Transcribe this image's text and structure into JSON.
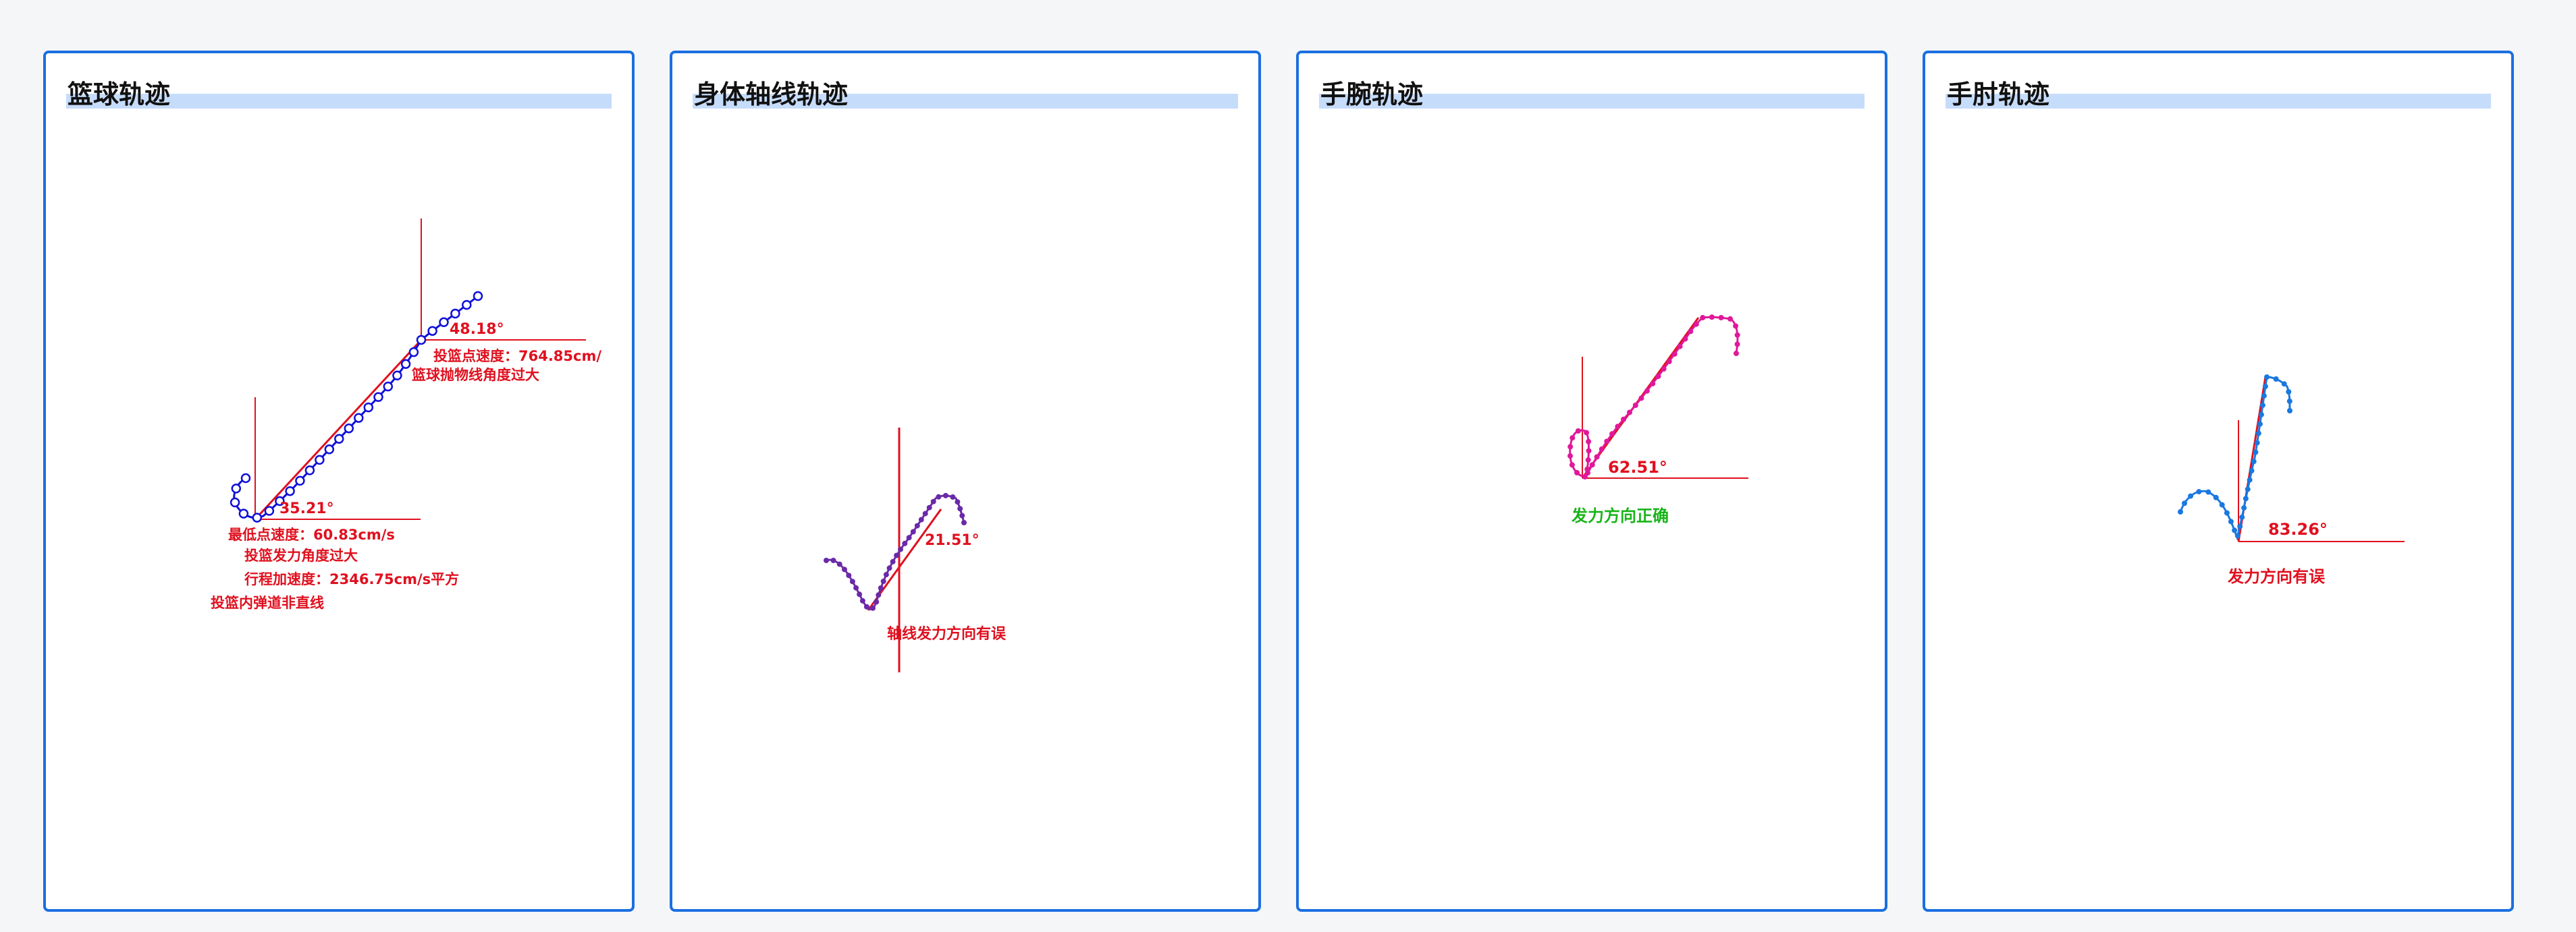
{
  "colors": {
    "page_bg": "#f5f6f8",
    "panel_border": "#1a6fe0",
    "title_highlight": "#c6dcfb",
    "guide_red": "#e0101f",
    "text_ok_green": "#18b418",
    "ball_trace": "#1010d8",
    "body_trace": "#6a2aa8",
    "wrist_trace": "#e0189a",
    "elbow_trace": "#1a78e0"
  },
  "panels": [
    {
      "title": "篮球轨迹",
      "release_angle": "48.18°",
      "release_speed": "投篮点速度：764.85cm/",
      "parabola_warning": "篮球抛物线角度过大",
      "low_angle": "35.21°",
      "low_speed": "最低点速度：60.83cm/s",
      "force_angle_warning": "投篮发力角度过大",
      "acceleration": "行程加速度：2346.75cm/s平方",
      "trajectory_warning": "投篮内弹道非直线"
    },
    {
      "title": "身体轴线轨迹",
      "angle": "21.51°",
      "message": "轴线发力方向有误"
    },
    {
      "title": "手腕轨迹",
      "angle": "62.51°",
      "message": "发力方向正确"
    },
    {
      "title": "手肘轨迹",
      "angle": "83.26°",
      "message": "发力方向有误"
    }
  ]
}
